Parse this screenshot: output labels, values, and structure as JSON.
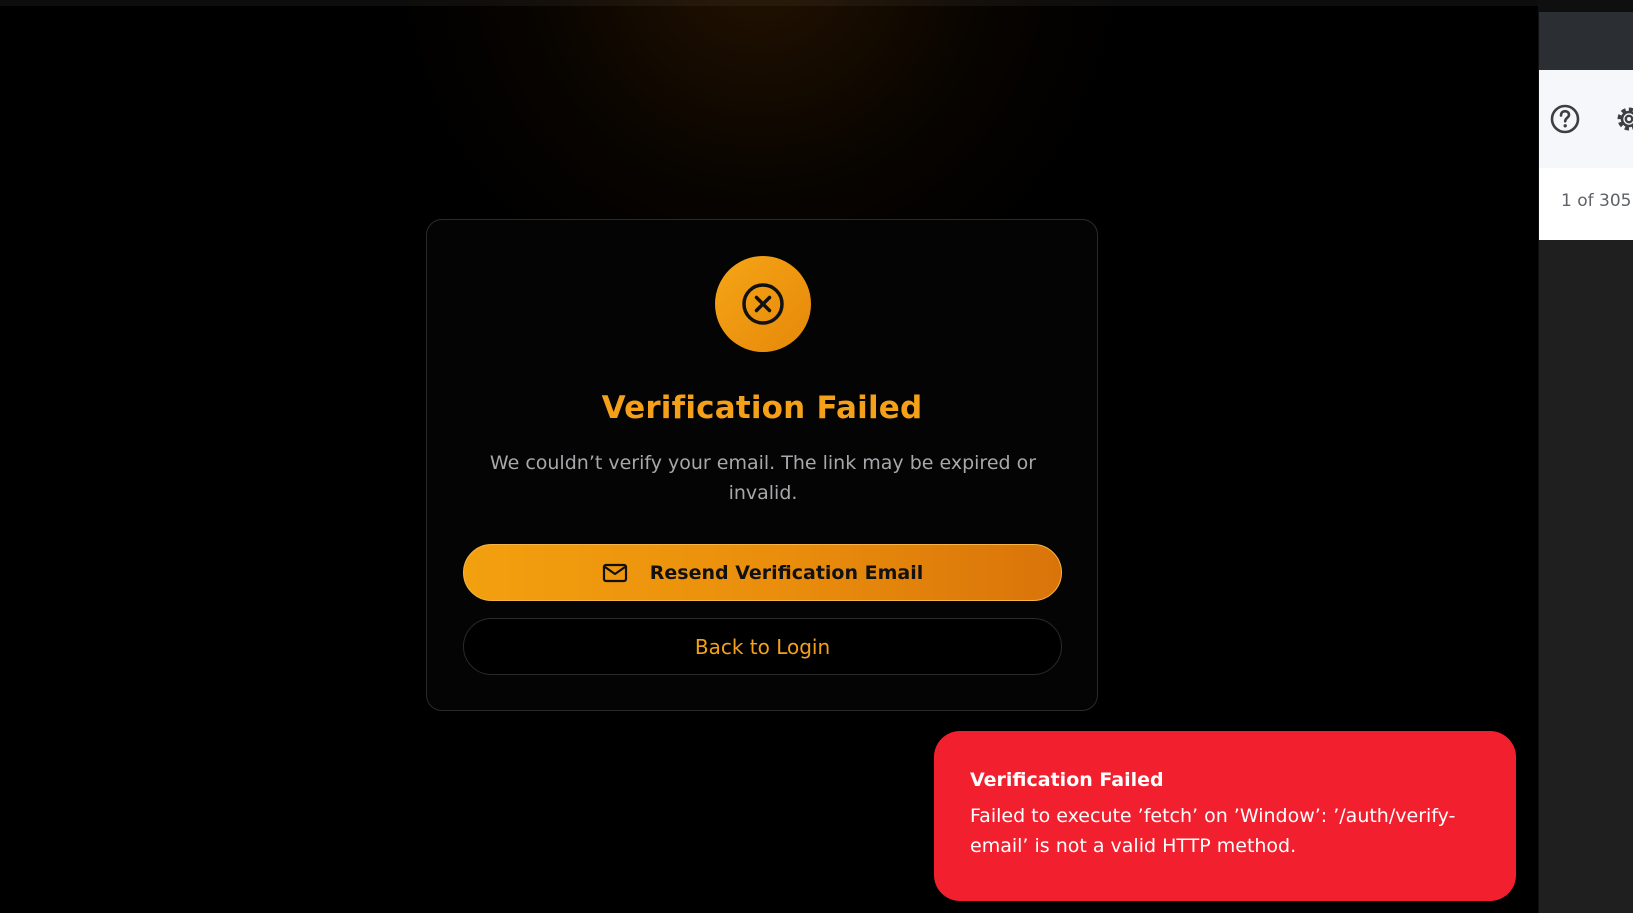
{
  "card": {
    "title": "Verification Failed",
    "message": "We couldn’t verify your email. The link may be expired or invalid.",
    "resend_label": "Resend Verification Email",
    "back_label": "Back to Login",
    "status_icon": "x-circle-icon",
    "accent_color": "#f4a119"
  },
  "toast": {
    "title": "Verification Failed",
    "body": "Failed to execute ’fetch’ on ’Window’: ’/auth/verify-email’ is not a valid HTTP method.",
    "background_color": "#f2202f"
  },
  "side_panel": {
    "help_icon": "help-circle-icon",
    "settings_icon": "gear-icon",
    "pager_text": "1 of 305"
  }
}
